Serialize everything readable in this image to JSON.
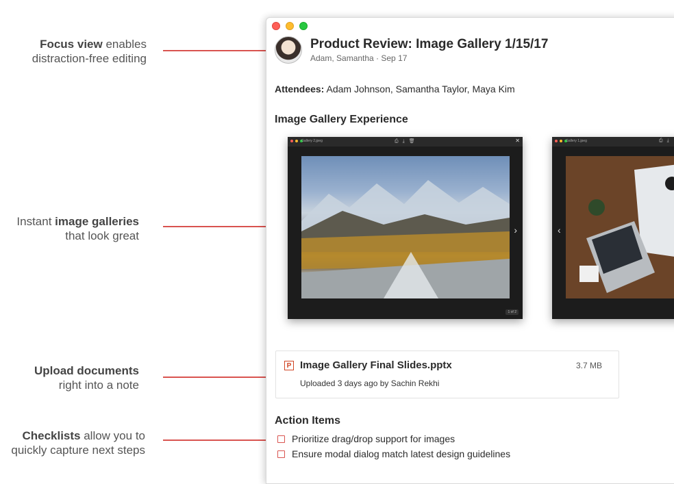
{
  "callouts": [
    {
      "strong": "Focus view",
      "rest": " enables",
      "line2": "distraction-free editing"
    },
    {
      "pre": "Instant ",
      "strong": "image galleries",
      "line2": "that look great"
    },
    {
      "strong": "Upload documents",
      "line2": "right into a note"
    },
    {
      "strong": "Checklists",
      "rest": " allow you to",
      "line2": "quickly capture next steps"
    }
  ],
  "note": {
    "title": "Product Review: Image Gallery 1/15/17",
    "subtitle": "Adam, Samantha · Sep 17",
    "attendees_label": "Attendees:",
    "attendees": "Adam Johnson, Samantha Taylor, Maya Kim",
    "gallery_heading": "Image Gallery Experience"
  },
  "gallery": [
    {
      "name": "Gallery 2.jpeg",
      "counter": "1 of 2",
      "icon": "mountain-photo"
    },
    {
      "name": "Gallery 1.jpeg",
      "icon": "desk-photo"
    }
  ],
  "attachment": {
    "icon_letter": "P",
    "name": "Image Gallery Final Slides.pptx",
    "size": "3.7 MB",
    "meta": "Uploaded 3 days ago by Sachin Rekhi"
  },
  "actions": {
    "heading": "Action Items",
    "items": [
      "Prioritize drag/drop support for images",
      "Ensure modal dialog match latest design guidelines"
    ]
  },
  "colors": {
    "accent": "#d9534f",
    "pptx": "#d04423"
  }
}
